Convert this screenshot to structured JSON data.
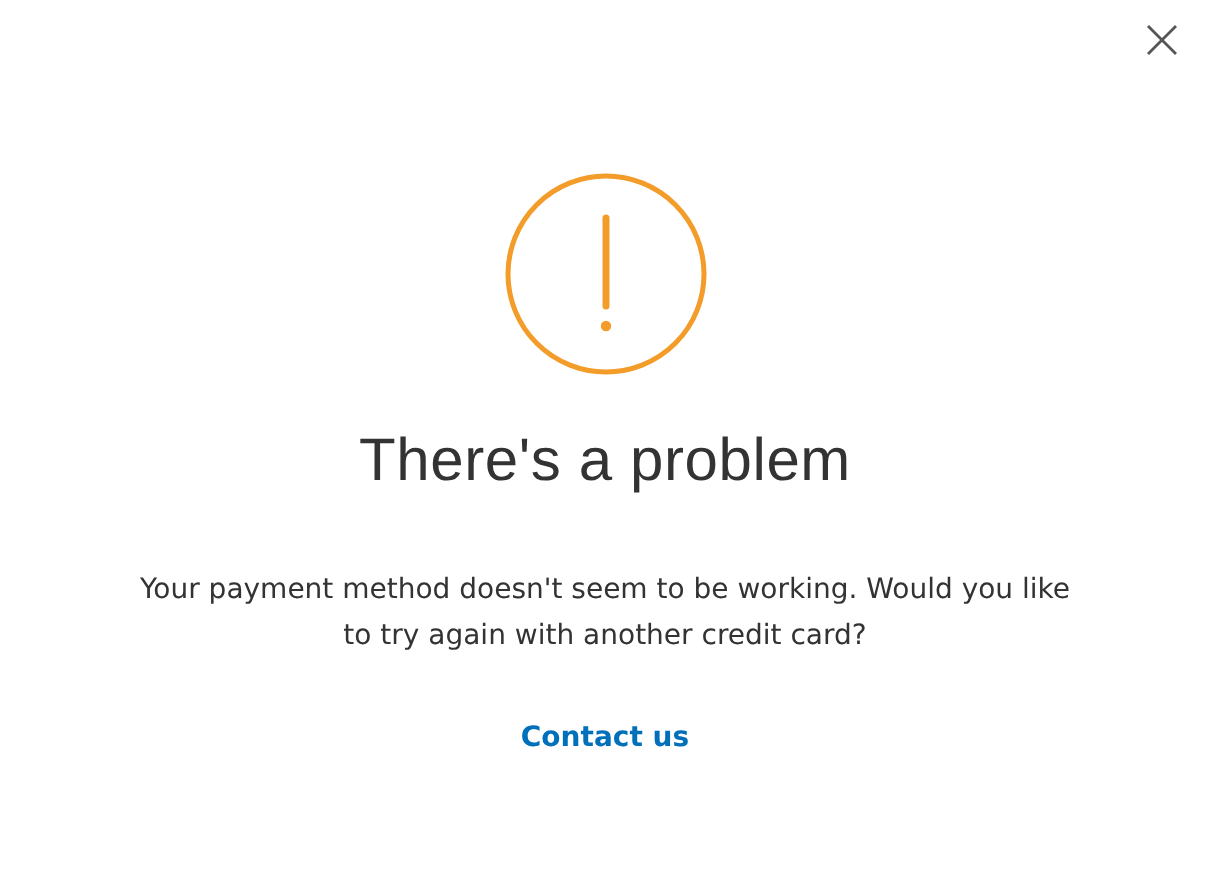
{
  "dialog": {
    "title": "There's a problem",
    "message": "Your payment method doesn't seem to be working. Would you like to try again with another credit card?",
    "link": "Contact us"
  }
}
